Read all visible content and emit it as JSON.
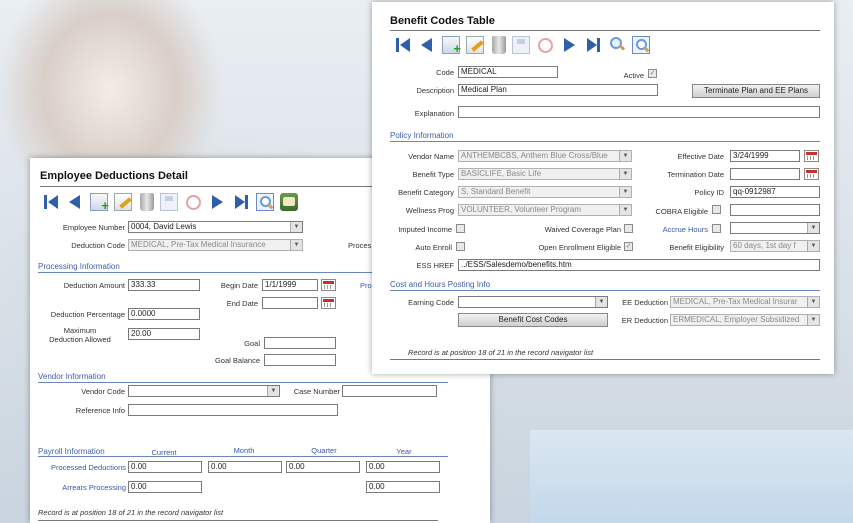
{
  "emp": {
    "title": "Employee Deductions Detail",
    "fields": {
      "employee_number_label": "Employee Number",
      "employee_number_value": "0004, David Lewis",
      "deduction_code_label": "Deduction Code",
      "deduction_code_value": "MEDICAL, Pre-Tax Medical Insurance",
      "proces_label": "Proces"
    },
    "processing": {
      "section": "Processing Information",
      "deduction_amount_label": "Deduction Amount",
      "deduction_amount_value": "333.33",
      "begin_date_label": "Begin Date",
      "begin_date_value": "1/1/1999",
      "pro_label": "Pro",
      "end_date_label": "End Date",
      "end_date_value": "",
      "deduction_percentage_label": "Deduction Percentage",
      "deduction_percentage_value": "0.0000",
      "max_label_1": "Maximum",
      "max_label_2": "Deduction Allowed",
      "max_value": "20.00",
      "goal_label": "Goal",
      "goal_value": "",
      "goal_balance_label": "Goal Balance",
      "goal_balance_value": ""
    },
    "vendor": {
      "section": "Vendor Information",
      "vendor_code_label": "Vendor Code",
      "vendor_code_value": "",
      "case_number_label": "Case Number",
      "case_number_value": "",
      "reference_info_label": "Reference Info",
      "reference_info_value": ""
    },
    "payroll": {
      "section": "Payroll Information",
      "col_current": "Current",
      "col_month": "Month",
      "col_quarter": "Quarter",
      "col_year": "Year",
      "processed_label": "Processed Deductions",
      "processed_values": [
        "0.00",
        "0.00",
        "0.00",
        "0.00"
      ],
      "arrears_label": "Arrears Processing",
      "arrears_values": [
        "0.00",
        "0.00"
      ]
    },
    "footer": "Record is at position 18 of 21 in the record navigator list"
  },
  "ben": {
    "title": "Benefit Codes Table",
    "code_label": "Code",
    "code_value": "MEDICAL",
    "active_label": "Active",
    "description_label": "Description",
    "description_value": "Medical Plan",
    "terminate_button": "Terminate Plan and EE Plans",
    "explanation_label": "Explanation",
    "explanation_value": "",
    "policy": {
      "section": "Policy Information",
      "vendor_name_label": "Vendor Name",
      "vendor_name_value": "ANTHEMBCBS, Anthem Blue Cross/Blue",
      "effective_date_label": "Effective Date",
      "effective_date_value": "3/24/1999",
      "benefit_type_label": "Benefit Type",
      "benefit_type_value": "BASICLIFE, Basic Life",
      "termination_date_label": "Termination Date",
      "termination_date_value": "",
      "benefit_category_label": "Benefit Category",
      "benefit_category_value": "S, Standard Benefit",
      "policy_id_label": "Policy ID",
      "policy_id_value": "qq-0912987",
      "wellness_prog_label": "Wellness Prog",
      "wellness_prog_value": "VOLUNTEER, Volunteer Program",
      "cobra_label": "COBRA Eligible",
      "cobra_value": "",
      "imputed_income_label": "Imputed Income",
      "waived_coverage_label": "Waived Coverage Plan",
      "accrue_hours_label": "Accrue Hours",
      "accrue_hours_value": "",
      "auto_enroll_label": "Auto Enroll",
      "open_enrollment_label": "Open Enrollment Eligible",
      "benefit_eligibility_label": "Benefit Eligibility",
      "benefit_eligibility_value": "60 days, 1st day f",
      "ess_href_label": "ESS HREF",
      "ess_href_value": "../ESS/Salesdemo/benefits.htm"
    },
    "cost": {
      "section": "Cost and Hours Posting Info",
      "earning_code_label": "Earning Code",
      "earning_code_value": "",
      "ee_deduction_label": "EE Deduction",
      "ee_deduction_value": "MEDICAL, Pre-Tax Medical Insurar",
      "er_deduction_label": "ER Deduction",
      "er_deduction_value": "ERMEDICAL, Employer Subsidized",
      "cost_codes_button": "Benefit Cost Codes"
    },
    "footer": "Record is at position 18 of 21 in the record navigator list"
  },
  "glyphs": {
    "arrow": "▼",
    "check": "✓"
  },
  "colors": {
    "section_blue": "#4060a8",
    "nav_blue": "#2e5fa8"
  }
}
